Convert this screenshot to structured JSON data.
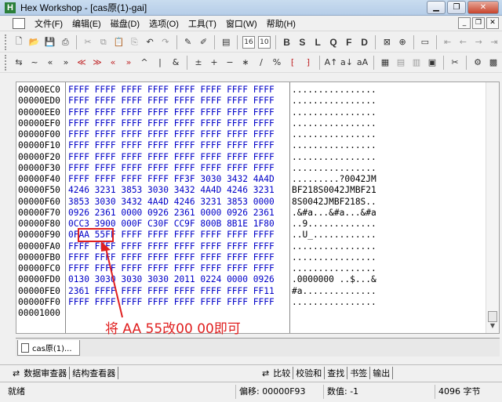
{
  "window": {
    "title": "Hex Workshop - [cas原(1)-gai]",
    "logo": "H"
  },
  "menu": [
    "文件(F)",
    "编辑(E)",
    "磁盘(D)",
    "选项(O)",
    "工具(T)",
    "窗口(W)",
    "帮助(H)"
  ],
  "toolbar_text": {
    "bold_b": "B",
    "bold_s": "S",
    "bold_l": "L",
    "bold_q": "Q",
    "bold_f": "F",
    "bold_d": "D"
  },
  "offsets": [
    "00000EC0",
    "00000ED0",
    "00000EE0",
    "00000EF0",
    "00000F00",
    "00000F10",
    "00000F20",
    "00000F30",
    "00000F40",
    "00000F50",
    "00000F60",
    "00000F70",
    "00000F80",
    "00000F90",
    "00000FA0",
    "00000FB0",
    "00000FC0",
    "00000FD0",
    "00000FE0",
    "00000FF0",
    "00001000"
  ],
  "hex": [
    "FFFF FFFF FFFF FFFF FFFF FFFF FFFF FFFF",
    "FFFF FFFF FFFF FFFF FFFF FFFF FFFF FFFF",
    "FFFF FFFF FFFF FFFF FFFF FFFF FFFF FFFF",
    "FFFF FFFF FFFF FFFF FFFF FFFF FFFF FFFF",
    "FFFF FFFF FFFF FFFF FFFF FFFF FFFF FFFF",
    "FFFF FFFF FFFF FFFF FFFF FFFF FFFF FFFF",
    "FFFF FFFF FFFF FFFF FFFF FFFF FFFF FFFF",
    "FFFF FFFF FFFF FFFF FFFF FFFF FFFF FFFF",
    "FFFF FFFF FFFF FFFF FF3F 3030 3432 4A4D",
    "4246 3231 3853 3030 3432 4A4D 4246 3231",
    "3853 3030 3432 4A4D 4246 3231 3853 0000",
    "0926 2361 0000 0926 2361 0000 0926 2361",
    "0CC3 3900 000F C30F CC9F 800B 8B1E 1F80",
    "0FAA 55FF FFFF FFFF FFFF FFFF FFFF FFFF",
    "FFFF FFFF FFFF FFFF FFFF FFFF FFFF FFFF",
    "FFFF FFFF FFFF FFFF FFFF FFFF FFFF FFFF",
    "FFFF FFFF FFFF FFFF FFFF FFFF FFFF FFFF",
    "0130 3030 3030 3030 2011 0224 0000 0926",
    "2361 FFFF FFFF FFFF FFFF FFFF FFFF FF11",
    "FFFF FFFF FFFF FFFF FFFF FFFF FFFF FFFF",
    ""
  ],
  "ascii": [
    "................",
    "................",
    "................",
    "................",
    "................",
    "................",
    "................",
    "................",
    ".........?0042JM",
    "BF218S0042JMBF21",
    "8S0042JMBF218S..",
    ".&#a...&#a...&#a",
    "..9.............",
    "..U_............",
    "................",
    "................",
    "................",
    ".0000000 ..$...&",
    "#a..............",
    "................",
    ""
  ],
  "annotation": "将 AA 55改00 00即可",
  "doc_tab": "cas原(1)...",
  "panels_left": [
    "数据审查器",
    "结构查看器"
  ],
  "panels_right": [
    "比较",
    "校验和",
    "查找",
    "书签",
    "输出"
  ],
  "status": {
    "ready": "就绪",
    "offset": "偏移: 00000F93",
    "value": "数值: -1",
    "size": "4096 字节"
  }
}
